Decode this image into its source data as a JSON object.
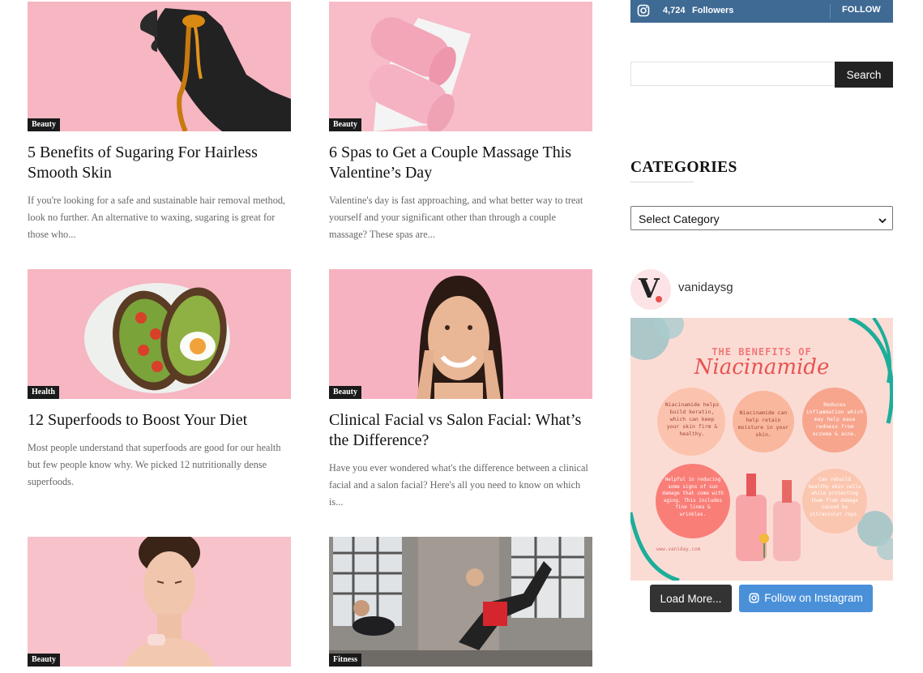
{
  "posts": [
    {
      "category": "Beauty",
      "title": "5 Benefits of Sugaring For Hairless Smooth Skin",
      "excerpt": "If you're looking for a safe and sustainable hair removal method, look no further. An alternative to waxing, sugaring is great for those who..."
    },
    {
      "category": "Beauty",
      "title": "6 Spas to Get a Couple Massage This Valentine’s Day",
      "excerpt": "Valentine's day is fast approaching, and what better way to treat yourself and your significant other than through a couple massage? These spas are..."
    },
    {
      "category": "Health",
      "title": "12 Superfoods to Boost Your Diet",
      "excerpt": "Most people understand that superfoods are good for our health but few people know why. We picked 12 nutritionally dense superfoods."
    },
    {
      "category": "Beauty",
      "title": "Clinical Facial vs Salon Facial: What’s the Difference?",
      "excerpt": "Have you ever wondered what's the difference between a clinical facial and a salon facial? Here's all you need to know on which is..."
    },
    {
      "category": "Beauty",
      "title": "",
      "excerpt": ""
    },
    {
      "category": "Fitness",
      "title": "",
      "excerpt": ""
    }
  ],
  "sidebar": {
    "instagram_bar": {
      "count": "4,724",
      "label": "Followers",
      "follow": "FOLLOW",
      "icon": "instagram-icon"
    },
    "search": {
      "value": "",
      "button": "Search"
    },
    "categories": {
      "heading": "CATEGORIES",
      "selected": "Select Category"
    },
    "feed": {
      "username": "vanidaysg",
      "avatar_letter": "V",
      "post": {
        "heading": "THE BENEFITS OF",
        "title": "Niacinamide",
        "bubbles": [
          "Niacinamide helps build keratin, which can keep your skin firm & healthy.",
          "Niacinamide can help retain moisture in your skin.",
          "Reduces inflammation which may help ease redness from eczema & acne.",
          "Helpful in reducing some signs of sun damage that come with aging. This includes fine lines & wrinkles.",
          "Can rebuild healthy skin cells while protecting them from damage caused by ultraviolet rays."
        ],
        "footer": "www.vaniday.com"
      },
      "load_more": "Load More...",
      "follow_instagram": "Follow on Instagram"
    }
  },
  "colors": {
    "instagram_bar": "#3e6a94",
    "follow_button": "#4a90d9",
    "pink": "#f7b8c4",
    "brand_dot": "#e8534f"
  }
}
